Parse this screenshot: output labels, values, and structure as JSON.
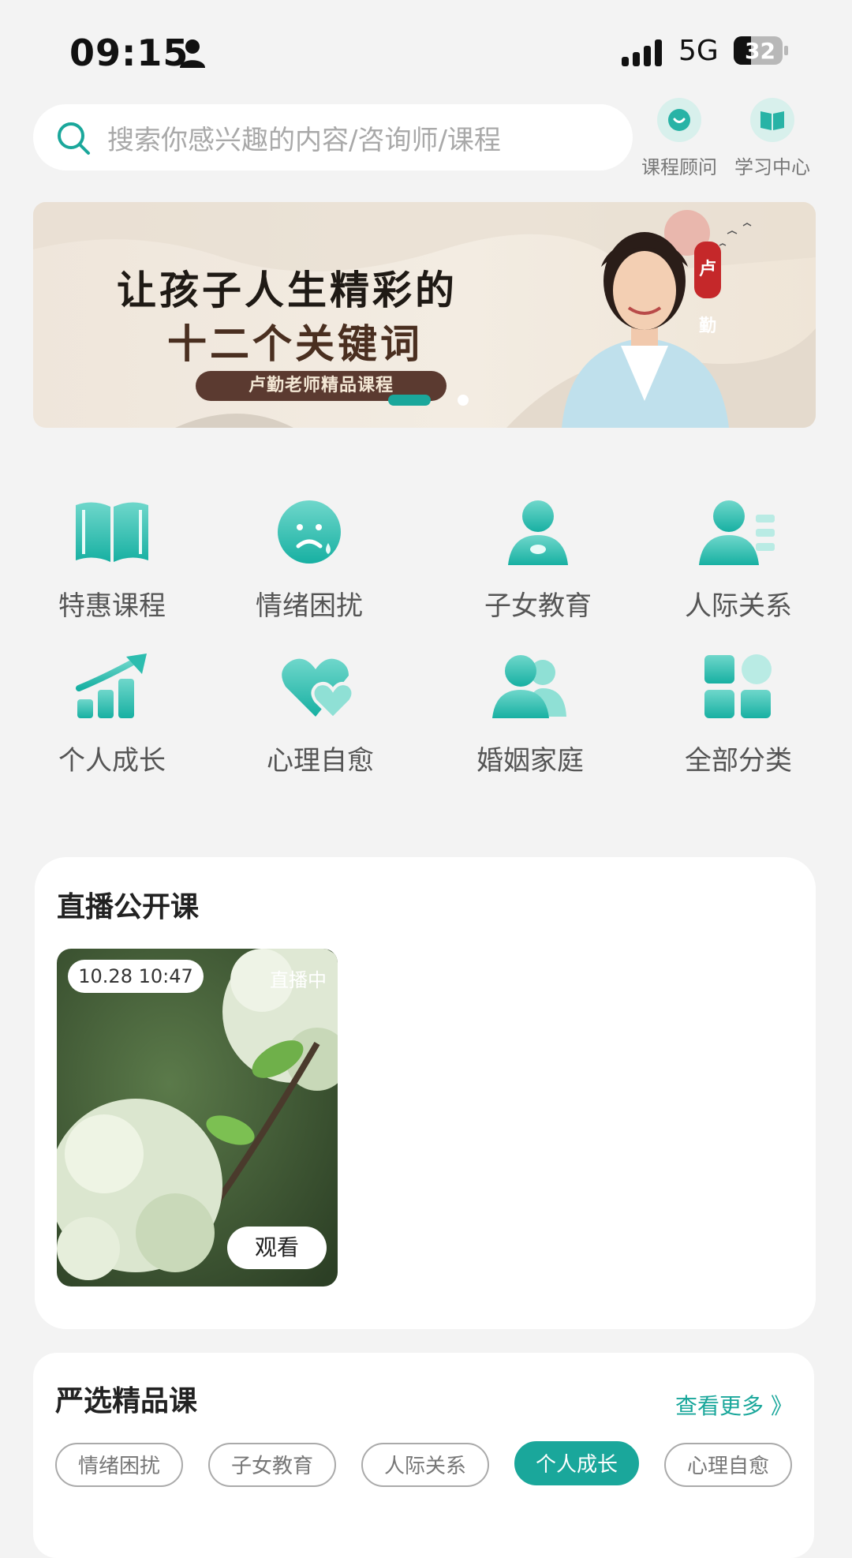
{
  "status_bar": {
    "time": "09:15",
    "network": "5G",
    "battery": "32"
  },
  "search": {
    "placeholder": "搜索你感兴趣的内容/咨询师/课程"
  },
  "top_buttons": [
    {
      "label": "课程顾问",
      "icon": "chat-bubble-icon"
    },
    {
      "label": "学习中心",
      "icon": "book-icon"
    }
  ],
  "banner": {
    "title_line1": "让孩子人生精彩的",
    "title_line2": "十二个关键词",
    "subtitle": "卢勤老师精品课程",
    "seal_text": "卢勤",
    "page_count": 2,
    "active_page": 1
  },
  "categories": [
    {
      "label": "特惠课程",
      "icon": "open-book-icon"
    },
    {
      "label": "情绪困扰",
      "icon": "sad-face-icon"
    },
    {
      "label": "子女教育",
      "icon": "person-icon"
    },
    {
      "label": "人际关系",
      "icon": "person-list-icon"
    },
    {
      "label": "个人成长",
      "icon": "growth-chart-icon"
    },
    {
      "label": "心理自愈",
      "icon": "hearts-icon"
    },
    {
      "label": "婚姻家庭",
      "icon": "couple-icon"
    },
    {
      "label": "全部分类",
      "icon": "grid-icon"
    }
  ],
  "live": {
    "title": "直播公开课",
    "card": {
      "time": "10.28 10:47",
      "status": "直播中",
      "watch_label": "观看"
    }
  },
  "premium": {
    "title": "严选精品课",
    "more_label": "查看更多 》",
    "tags": [
      "情绪困扰",
      "子女教育",
      "人际关系",
      "个人成长",
      "心理自愈"
    ],
    "active_tag": "个人成长"
  },
  "colors": {
    "accent": "#1aa79b",
    "background": "#f3f3f3"
  }
}
